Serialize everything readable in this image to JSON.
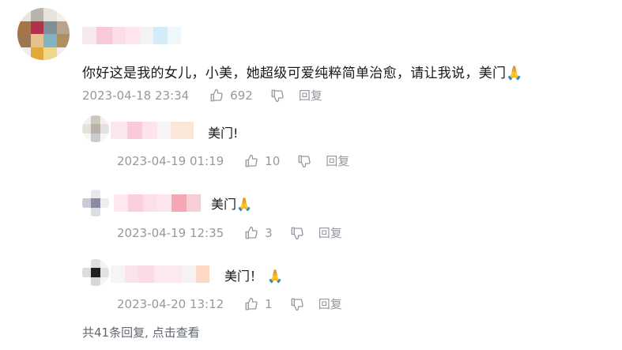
{
  "comment": {
    "text": "你好这是我的女儿，小美，她超级可爱纯粹简单治愈，请让我说，美门",
    "emoji": "🙏",
    "timestamp": "2023-04-18 23:34",
    "likes": "692",
    "reply_label": "回复"
  },
  "replies": [
    {
      "text": "美门!",
      "emoji": "",
      "timestamp": "2023-04-19 01:19",
      "likes": "10",
      "reply_label": "回复"
    },
    {
      "text": "美门",
      "emoji": "🙏",
      "timestamp": "2023-04-19 12:35",
      "likes": "3",
      "reply_label": "回复"
    },
    {
      "text": "美门！",
      "emoji": "🙏",
      "timestamp": "2023-04-20 13:12",
      "likes": "1",
      "reply_label": "回复"
    }
  ],
  "footer": {
    "more_replies": "共41条回复, 点击查看"
  },
  "colors": {
    "meta": "#9499a0",
    "text": "#18191c",
    "emoji": "#f2b33d"
  },
  "icons": [
    "thumbs-up-icon",
    "thumbs-down-icon"
  ]
}
